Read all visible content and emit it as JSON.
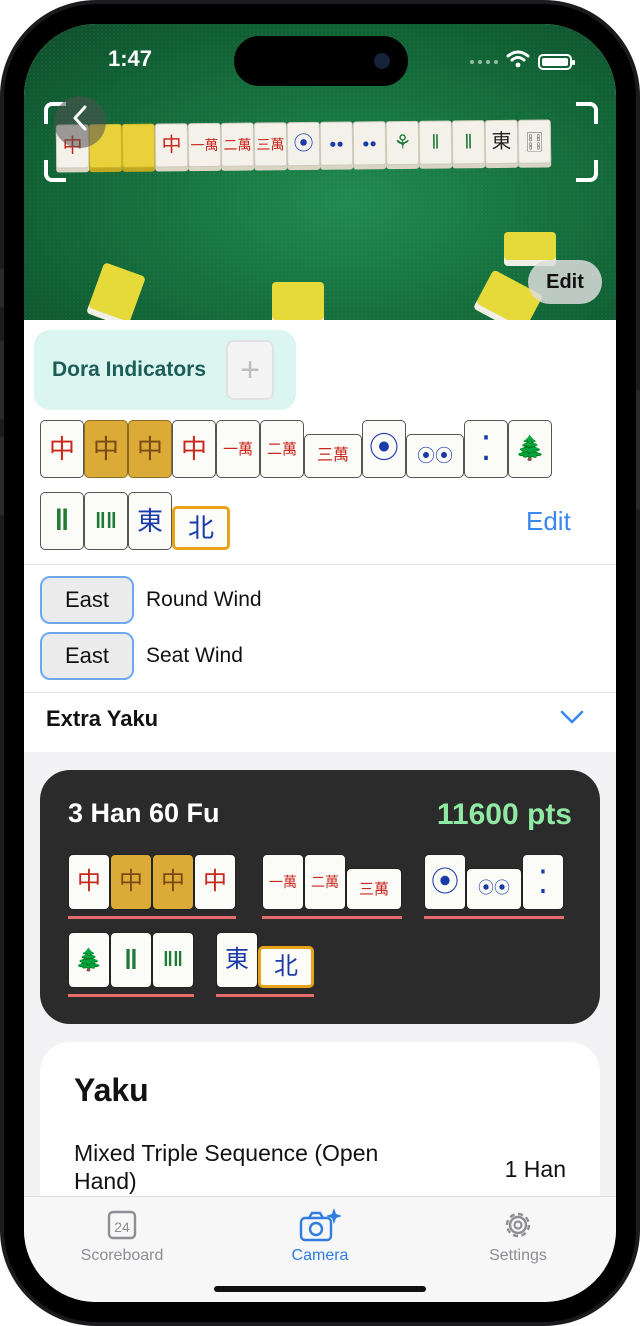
{
  "status_bar": {
    "time": "1:47"
  },
  "camera": {
    "photo_tiles": [
      "中",
      "",
      "",
      "中",
      "一萬",
      "二萬",
      "三萬",
      "⦿",
      "●●",
      "●●",
      "⚘",
      "‖",
      "‖",
      "東",
      "🀓"
    ],
    "edit_label": "Edit"
  },
  "dora": {
    "label": "Dora Indicators",
    "add_icon": "+"
  },
  "hand": {
    "row1": [
      {
        "glyph": "中",
        "suit": "red",
        "selected": false
      },
      {
        "glyph": "中",
        "suit": "red",
        "selected": true
      },
      {
        "glyph": "中",
        "suit": "red",
        "selected": true
      },
      {
        "glyph": "中",
        "suit": "red",
        "selected": false
      },
      {
        "glyph": "一萬",
        "suit": "red",
        "selected": false
      },
      {
        "glyph": "二萬",
        "suit": "red",
        "selected": false
      },
      {
        "glyph": "三萬",
        "suit": "red",
        "selected": false
      },
      {
        "glyph": "⦿",
        "suit": "blu",
        "selected": false
      },
      {
        "glyph": "⦿⦿",
        "suit": "blu",
        "selected": false
      },
      {
        "glyph": "⁚",
        "suit": "blu",
        "selected": false
      },
      {
        "glyph": "🌲",
        "suit": "grn",
        "selected": false
      }
    ],
    "row2": [
      {
        "glyph": "‖",
        "suit": "grn"
      },
      {
        "glyph": "‖‖",
        "suit": "grn"
      },
      {
        "glyph": "東",
        "suit": "blu"
      },
      {
        "glyph": "北",
        "suit": "blu",
        "highlight": true
      }
    ],
    "edit_label": "Edit"
  },
  "winds": {
    "round": {
      "value": "East",
      "label": "Round Wind"
    },
    "seat": {
      "value": "East",
      "label": "Seat Wind"
    }
  },
  "extra_yaku": {
    "label": "Extra Yaku"
  },
  "score": {
    "han_fu": "3 Han   60 Fu",
    "points": "11600 pts",
    "colors": {
      "points": "#8fe9a3",
      "meld_underline": "#e76b6b",
      "selected_tile": "#dcaa36"
    }
  },
  "yaku": {
    "title": "Yaku",
    "items": [
      {
        "name": "Mixed Triple Sequence (Open Hand)",
        "han": "1 Han"
      }
    ]
  },
  "tabs": [
    {
      "label": "Scoreboard",
      "icon": "calendar-icon",
      "badge": "24",
      "active": false
    },
    {
      "label": "Camera",
      "icon": "camera-sparkle-icon",
      "active": true
    },
    {
      "label": "Settings",
      "icon": "gear-icon",
      "active": false
    }
  ],
  "colors": {
    "accent": "#3a87f0",
    "dora_bg": "#dbf5f1",
    "dora_text": "#1d5d57"
  }
}
